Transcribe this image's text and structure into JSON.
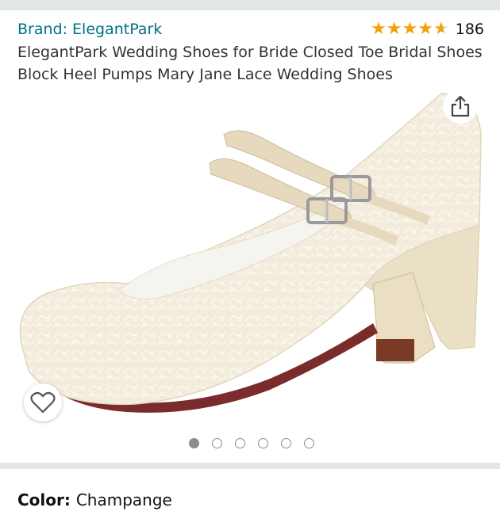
{
  "brand": {
    "link_text": "Brand: ElegantPark"
  },
  "rating": {
    "stars": 4.5,
    "count": "186",
    "star_color": "#f2a20c"
  },
  "product": {
    "title": "ElegantPark Wedding Shoes for Bride Closed Toe Bridal Shoes Block Heel Pumps Mary Jane Lace Wedding Shoes"
  },
  "image": {
    "current_index": 1,
    "total": 6
  },
  "actions": {
    "share_icon": "share-icon",
    "wishlist_icon": "heart-outline-icon"
  },
  "variation": {
    "label": "Color:",
    "value": "Champange"
  },
  "colors": {
    "link": "#007185",
    "shoe": "#f3ecdd",
    "strap": "#e6d9bd",
    "heel": "#eae0c6"
  }
}
